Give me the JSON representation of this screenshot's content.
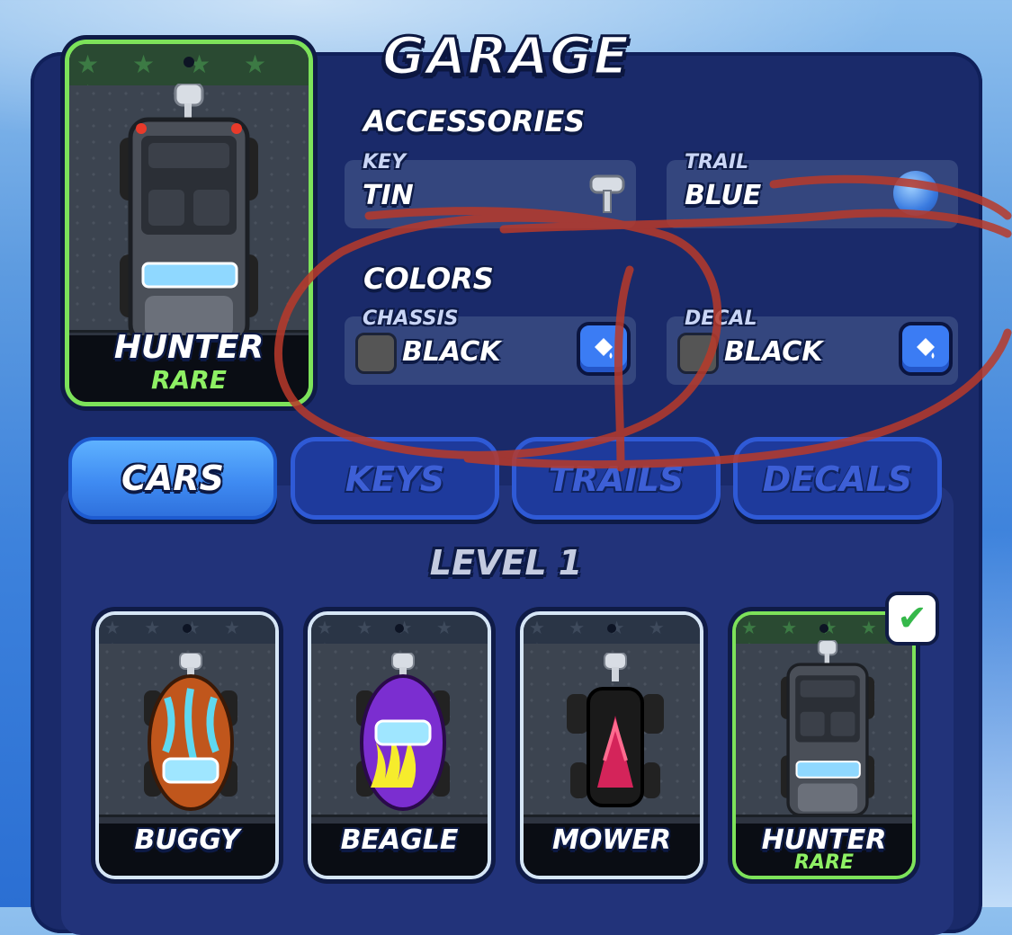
{
  "title": "GARAGE",
  "selected_car": {
    "name": "HUNTER",
    "rarity": "RARE"
  },
  "accessories": {
    "heading": "ACCESSORIES",
    "key": {
      "label": "KEY",
      "value": "TIN",
      "icon": "wind-up-key-icon"
    },
    "trail": {
      "label": "TRAIL",
      "value": "BLUE",
      "icon": "blue-blob-icon"
    }
  },
  "colors": {
    "heading": "COLORS",
    "chassis": {
      "label": "CHASSIS",
      "value": "BLACK",
      "swatch": "#555555",
      "icon": "paint-bucket-icon"
    },
    "decal": {
      "label": "DECAL",
      "value": "BLACK",
      "swatch": "#555555",
      "icon": "paint-bucket-icon"
    }
  },
  "tabs": [
    {
      "label": "CARS",
      "active": true
    },
    {
      "label": "KEYS",
      "active": false
    },
    {
      "label": "TRAILS",
      "active": false
    },
    {
      "label": "DECALS",
      "active": false
    }
  ],
  "level_heading": "LEVEL 1",
  "cars": [
    {
      "name": "BUGGY",
      "rarity": "",
      "color": "#c0561c",
      "accent": "#5fd8f0"
    },
    {
      "name": "BEAGLE",
      "rarity": "",
      "color": "#7b2ed0",
      "accent": "#f6ec2c"
    },
    {
      "name": "MOWER",
      "rarity": "",
      "color": "#1a1a1a",
      "accent": "#d4245a"
    },
    {
      "name": "HUNTER",
      "rarity": "RARE",
      "color": "#3a3e46",
      "accent": "#a6e4ff",
      "selected": true
    }
  ],
  "selected_check_icon": "checkmark-icon"
}
